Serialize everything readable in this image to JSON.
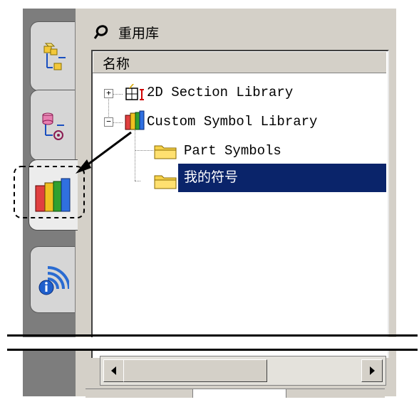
{
  "panel": {
    "title": "重用库",
    "title_icon": "pin-icon",
    "column_header": "名称"
  },
  "side_tabs": [
    {
      "name": "assemblies",
      "icon": "assembly-tree-icon",
      "active": false
    },
    {
      "name": "parts",
      "icon": "part-tree-icon",
      "active": false
    },
    {
      "name": "reuse-library",
      "icon": "library-books-icon",
      "active": true
    },
    {
      "name": "info",
      "icon": "info-signal-icon",
      "active": false
    }
  ],
  "tree": {
    "nodes": [
      {
        "label": "2D Section Library",
        "icon": "section-library-icon",
        "expander": "+"
      },
      {
        "label": "Custom Symbol Library",
        "icon": "library-books-icon",
        "expander": "−"
      },
      {
        "label": "Part Symbols",
        "icon": "folder-icon"
      },
      {
        "label": "我的符号",
        "icon": "folder-icon",
        "selected": true
      }
    ]
  },
  "colors": {
    "selection": "#0a246a",
    "panel_bg": "#d4d0c8",
    "dark_bar": "#7d7d7d"
  }
}
